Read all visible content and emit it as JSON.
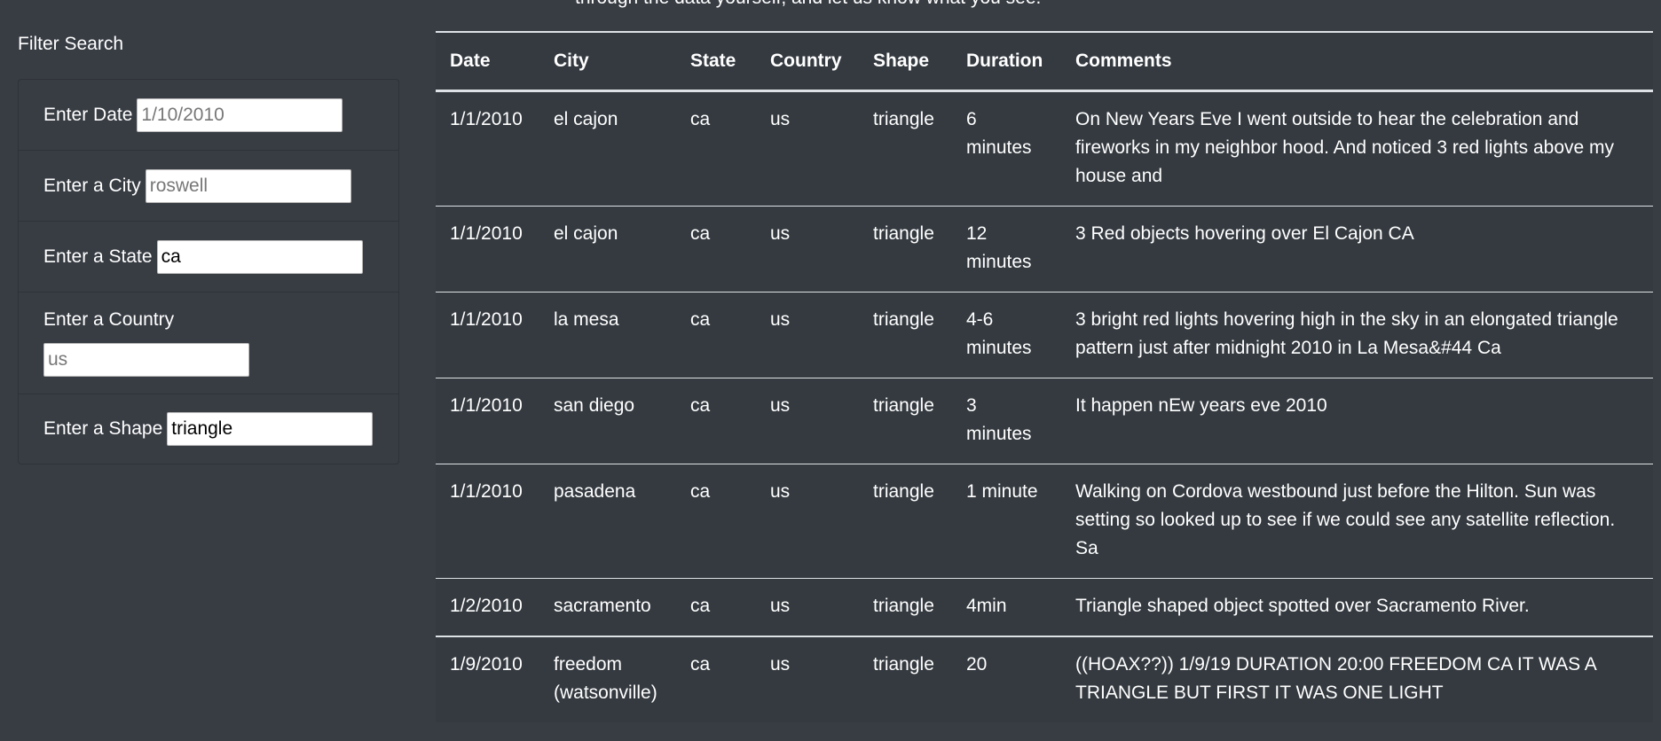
{
  "intro_text": "through the data yourself, and let us know what you see.",
  "filter": {
    "title": "Filter Search",
    "fields": [
      {
        "label": "Enter Date",
        "value": "",
        "placeholder": "1/10/2010"
      },
      {
        "label": "Enter a City",
        "value": "",
        "placeholder": "roswell"
      },
      {
        "label": "Enter a State",
        "value": "ca",
        "placeholder": ""
      },
      {
        "label": "Enter a Country",
        "value": "",
        "placeholder": "us"
      },
      {
        "label": "Enter a Shape",
        "value": "triangle",
        "placeholder": ""
      }
    ]
  },
  "table": {
    "headers": [
      "Date",
      "City",
      "State",
      "Country",
      "Shape",
      "Duration",
      "Comments"
    ],
    "rows": [
      [
        "1/1/2010",
        "el cajon",
        "ca",
        "us",
        "triangle",
        "6 minutes",
        "On New Years Eve I went outside to hear the celebration and fireworks in my neighbor hood. And noticed 3 red lights above my house and"
      ],
      [
        "1/1/2010",
        "el cajon",
        "ca",
        "us",
        "triangle",
        "12 minutes",
        "3 Red objects hovering over El Cajon CA"
      ],
      [
        "1/1/2010",
        "la mesa",
        "ca",
        "us",
        "triangle",
        "4-6 minutes",
        "3 bright red lights hovering high in the sky in an elongated triangle pattern just after midnight 2010 in La Mesa&#44 Ca"
      ],
      [
        "1/1/2010",
        "san diego",
        "ca",
        "us",
        "triangle",
        "3 minutes",
        "It happen nEw years eve 2010"
      ],
      [
        "1/1/2010",
        "pasadena",
        "ca",
        "us",
        "triangle",
        "1 minute",
        "Walking on Cordova westbound just before the Hilton. Sun was setting so looked up to see if we could see any satellite reflection. Sa"
      ],
      [
        "1/2/2010",
        "sacramento",
        "ca",
        "us",
        "triangle",
        "4min",
        "Triangle shaped object spotted over Sacramento River."
      ],
      [
        "1/9/2010",
        "freedom (watsonville)",
        "ca",
        "us",
        "triangle",
        "20",
        "((HOAX??)) 1/9/19 DURATION 20:00 FREEDOM CA IT WAS A TRIANGLE BUT FIRST IT WAS ONE LIGHT"
      ]
    ]
  }
}
